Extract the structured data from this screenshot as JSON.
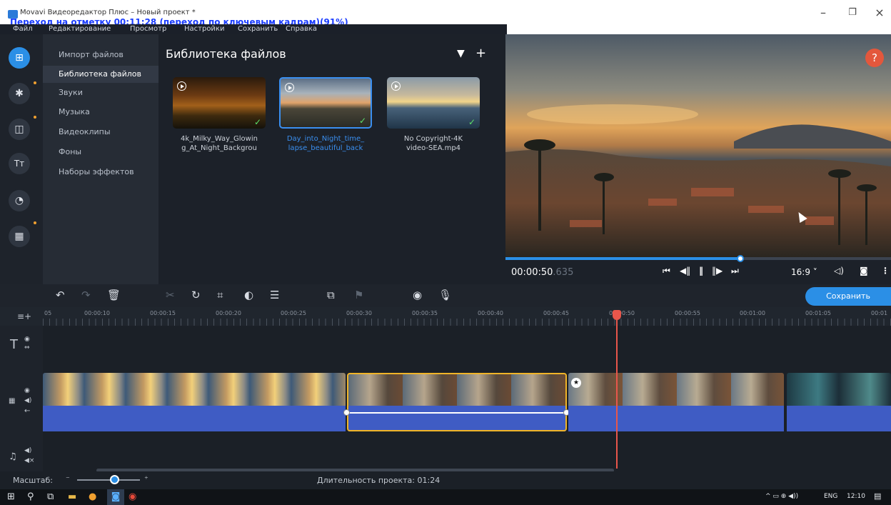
{
  "window": {
    "title": "Movavi Видеоредактор Плюс – Новый проект *",
    "overlay": "Переход на отметку 00:11:28 (переход по ключевым кадрам)(91%)",
    "controls": [
      "–",
      "❐",
      "×"
    ]
  },
  "menu": [
    "Файл",
    "Редактирование",
    "Просмотр",
    "Настройки",
    "Сохранить",
    "Справка"
  ],
  "categories": [
    "Импорт файлов",
    "Библиотека файлов",
    "Звуки",
    "Музыка",
    "Видеоклипы",
    "Фоны",
    "Наборы эффектов"
  ],
  "rail_icons": [
    "import-icon",
    "pin-icon",
    "transition-icon",
    "text-icon",
    "sticker-icon",
    "grid-icon"
  ],
  "library": {
    "title": "Библиотека файлов",
    "files": [
      {
        "name": "4k_Milky_Way_Glowing_At_Night_Backgrou",
        "line1": "4k_Milky_Way_Glowin",
        "line2": "g_At_Night_Backgrou",
        "selected": false
      },
      {
        "name": "Day_into_Night_time_lapse_beautiful_back",
        "line1": "Day_into_Night_time_",
        "line2": "lapse_beautiful_back",
        "selected": true
      },
      {
        "name": "No Copyright-4K video-SEA.mp4",
        "line1": "No Copyright-4K",
        "line2": "video-SEA.mp4",
        "selected": false
      }
    ]
  },
  "preview": {
    "help": "?",
    "timecode_main": "00:00:50",
    "timecode_ms": ".635",
    "progress": 0.61,
    "aspect": "16:9 ˅"
  },
  "toolbar": {
    "save_label": "Сохранить"
  },
  "ruler": [
    "05",
    "00:00:10",
    "00:00:15",
    "00:00:20",
    "00:00:25",
    "00:00:30",
    "00:00:35",
    "00:00:40",
    "00:00:45",
    "00:00:50",
    "00:00:55",
    "00:01:00",
    "00:01:05",
    "00:01"
  ],
  "status": {
    "zoom_label": "Масштаб:",
    "duration": "Длительность проекта: 01:24"
  },
  "taskbar": {
    "lang": "ENG",
    "time": "12:10"
  },
  "colors": {
    "accent": "#2b8fe6",
    "selection": "#f0b428",
    "playhead": "#e8564b",
    "audio": "#3f5cc4"
  }
}
